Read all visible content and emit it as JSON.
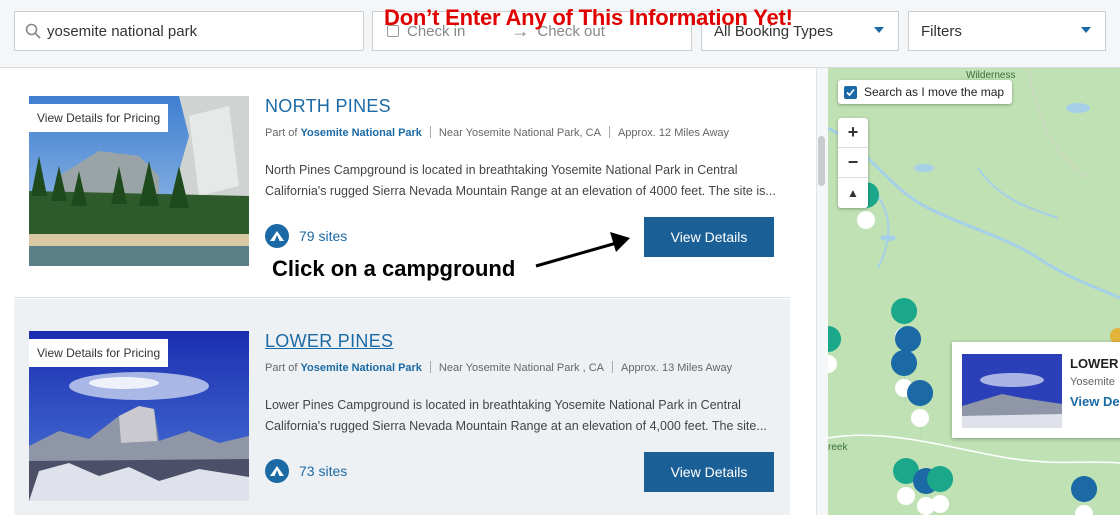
{
  "header": {
    "search_value": "yosemite national park",
    "check_in": "Check in",
    "check_out": "Check out",
    "booking_types": "All Booking Types",
    "filters": "Filters",
    "warning": "Don’t Enter Any of This Information Yet!"
  },
  "results": [
    {
      "badge": "View Details for Pricing",
      "title": "NORTH PINES",
      "part_of_prefix": "Part of",
      "part_of": "Yosemite National Park",
      "near": "Near Yosemite National Park, CA",
      "distance": "Approx. 12 Miles Away",
      "description": "North Pines Campground is located in breathtaking Yosemite National Park in Central California's rugged Sierra Nevada Mountain Range at an elevation of 4000 feet. The site is...",
      "sites": "79 sites",
      "button": "View Details"
    },
    {
      "badge": "View Details for Pricing",
      "title": "LOWER PINES",
      "part_of_prefix": "Part of",
      "part_of": "Yosemite National Park",
      "near": "Near Yosemite National Park , CA",
      "distance": "Approx. 13 Miles Away",
      "description": "Lower Pines Campground is located in breathtaking Yosemite National Park in Central California's rugged Sierra Nevada Mountain Range at an elevation of 4,000 feet. The site...",
      "sites": "73 sites",
      "button": "View Details"
    }
  ],
  "annotation": "Click on a campground",
  "map": {
    "search_as_move": "Search as I move the map",
    "zoom_in": "+",
    "zoom_out": "−",
    "compass": "▲",
    "label_wilderness": "Wilderness",
    "label_creek": "reek",
    "popup_title": "LOWER",
    "popup_sub": "Yosemite",
    "popup_view": "View De"
  },
  "colors": {
    "accent": "#1b6aa5",
    "button": "#1b5f97",
    "warning": "#e00000",
    "map": "#bfe1b3"
  }
}
